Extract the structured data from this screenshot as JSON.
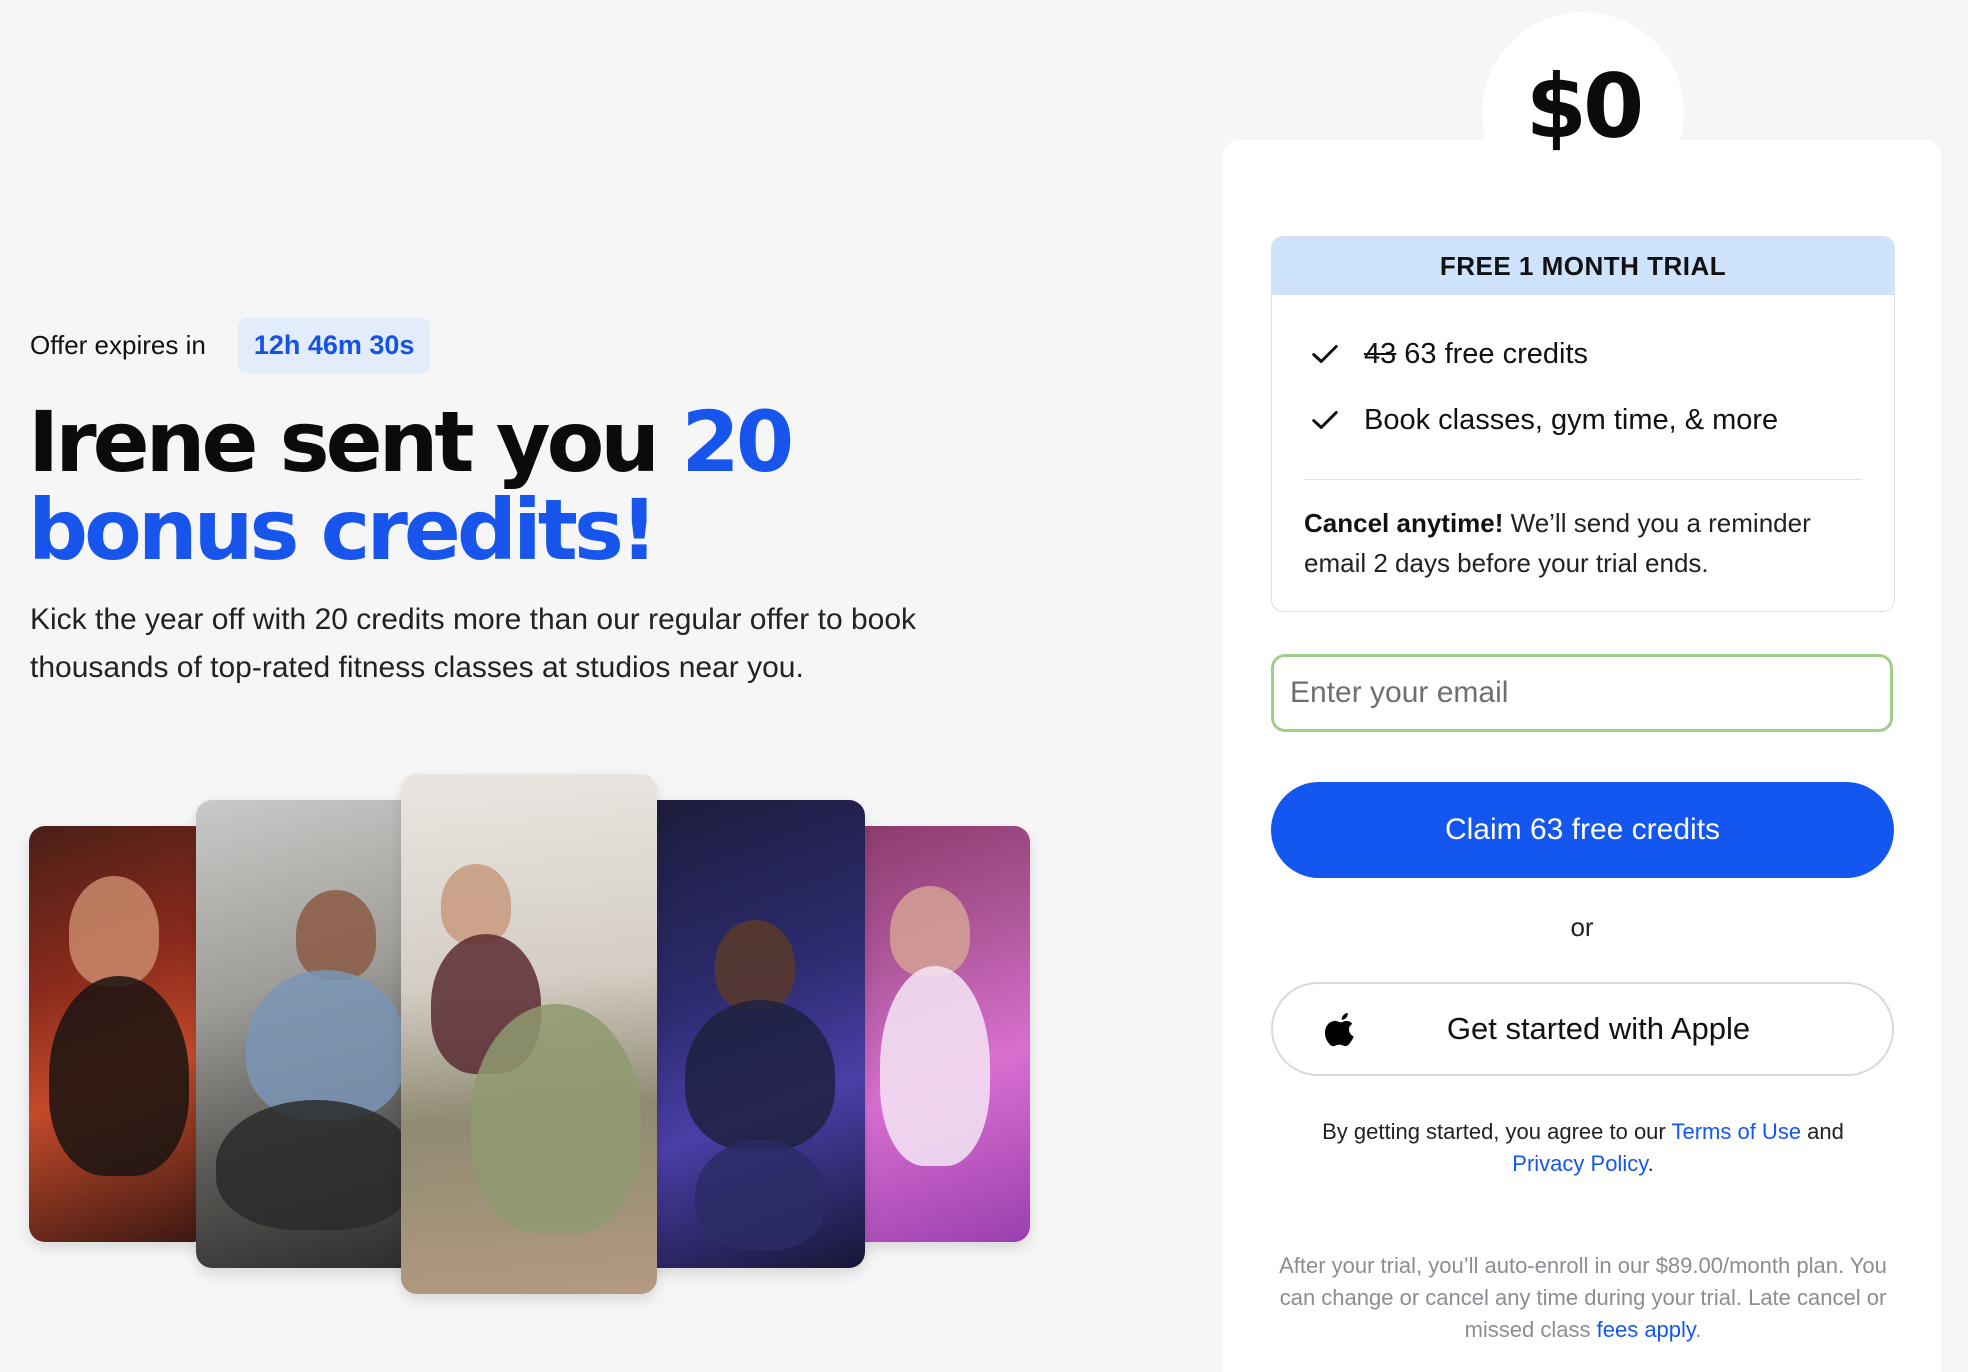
{
  "offer": {
    "label": "Offer expires in",
    "countdown": "12h 46m 30s"
  },
  "hero": {
    "headline_plain": "Irene sent you ",
    "headline_accent": "20 bonus credits!",
    "subtitle": "Kick the year off with 20 credits more than our regular offer to book thousands of top-rated fitness classes at studios near you."
  },
  "photos": [
    {
      "name": "cycling-class-photo"
    },
    {
      "name": "strength-training-photo"
    },
    {
      "name": "yoga-class-photo"
    },
    {
      "name": "boxing-class-photo"
    },
    {
      "name": "sauna-photo"
    }
  ],
  "signup": {
    "price": "$0",
    "trial_title": "FREE 1 MONTH TRIAL",
    "benefits": {
      "credits_old": "43",
      "credits_new": "63 free credits",
      "book": "Book classes, gym time, & more"
    },
    "cancel_bold": "Cancel anytime!",
    "cancel_text": " We’ll send you a reminder email 2 days before your trial ends.",
    "email_placeholder": "Enter your email",
    "claim_label": "Claim 63 free credits",
    "or_text": "or",
    "apple_label": "Get started with Apple",
    "legal_prefix": "By getting started, you agree to our ",
    "terms_link": "Terms of Use",
    "legal_and": " and",
    "privacy_link": "Privacy Policy",
    "legal_suffix": ".",
    "fineprint_text": "After your trial, you’ll auto-enroll in our $89.00/month plan. You can change or cancel any time during your trial. Late cancel or missed class ",
    "fees_link": "fees apply",
    "fineprint_suffix": "."
  },
  "colors": {
    "accent": "#1457f0",
    "countdown_bg": "#e3ecfb",
    "trial_header_bg": "#cfe2fb",
    "input_border": "#9fd08a"
  }
}
